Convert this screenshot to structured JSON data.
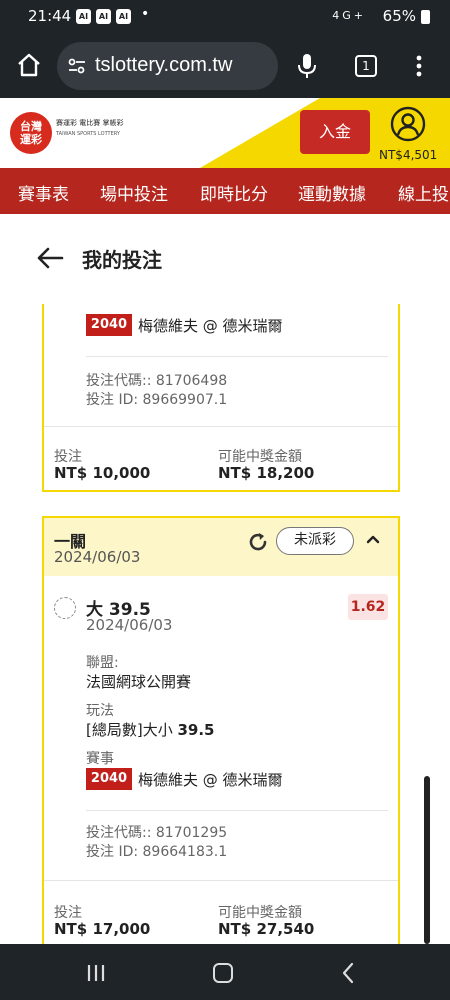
{
  "status_bar": {
    "time": "21:44",
    "ai_badges": [
      "AI",
      "AI",
      "AI"
    ],
    "dot": "•",
    "network": "4G+",
    "battery": "65%"
  },
  "browser": {
    "url": "tslottery.com.tw",
    "tab_count": "1"
  },
  "site_header": {
    "logo_badge": "台灣運彩",
    "logo_products": "賽運彩  電比賽  掌帳彩",
    "logo_english": "TAIWAN SPORTS LOTTERY",
    "deposit_label": "入金",
    "balance": "NT$4,501"
  },
  "main_nav": {
    "items": [
      "賽事表",
      "場中投注",
      "即時比分",
      "運動數據",
      "線上投"
    ]
  },
  "page": {
    "title": "我的投注"
  },
  "bets": [
    {
      "event_code": "2040",
      "event_teams": "梅德維夫 @ 德米瑞爾",
      "bet_code_line": "投注代碼:: 81706498",
      "bet_id_line": "投注 ID: 89669907.1",
      "stake_label": "投注",
      "stake_value": "NT$ 10,000",
      "payout_label": "可能中獎金額",
      "payout_value": "NT$ 18,200"
    },
    {
      "type": "一關",
      "date": "2024/06/03",
      "status": "未派彩",
      "selection": "大 39.5",
      "selection_date": "2024/06/03",
      "odds": "1.62",
      "league_label": "聯盟:",
      "league_value": "法國網球公開賽",
      "market_label": "玩法",
      "market_value_prefix": "[總局數]大小 ",
      "market_value_line": "39.5",
      "event_label": "賽事",
      "event_code": "2040",
      "event_teams": "梅德維夫 @ 德米瑞爾",
      "bet_code_line": "投注代碼:: 81701295",
      "bet_id_line": "投注 ID: 89664183.1",
      "stake_label": "投注",
      "stake_value": "NT$ 17,000",
      "payout_label": "可能中獎金額",
      "payout_value": "NT$ 27,540"
    }
  ],
  "colors": {
    "brand_red": "#b5261e",
    "brand_yellow": "#f5d800",
    "odds_red": "#b5261e",
    "system_bar": "#1f2428"
  }
}
